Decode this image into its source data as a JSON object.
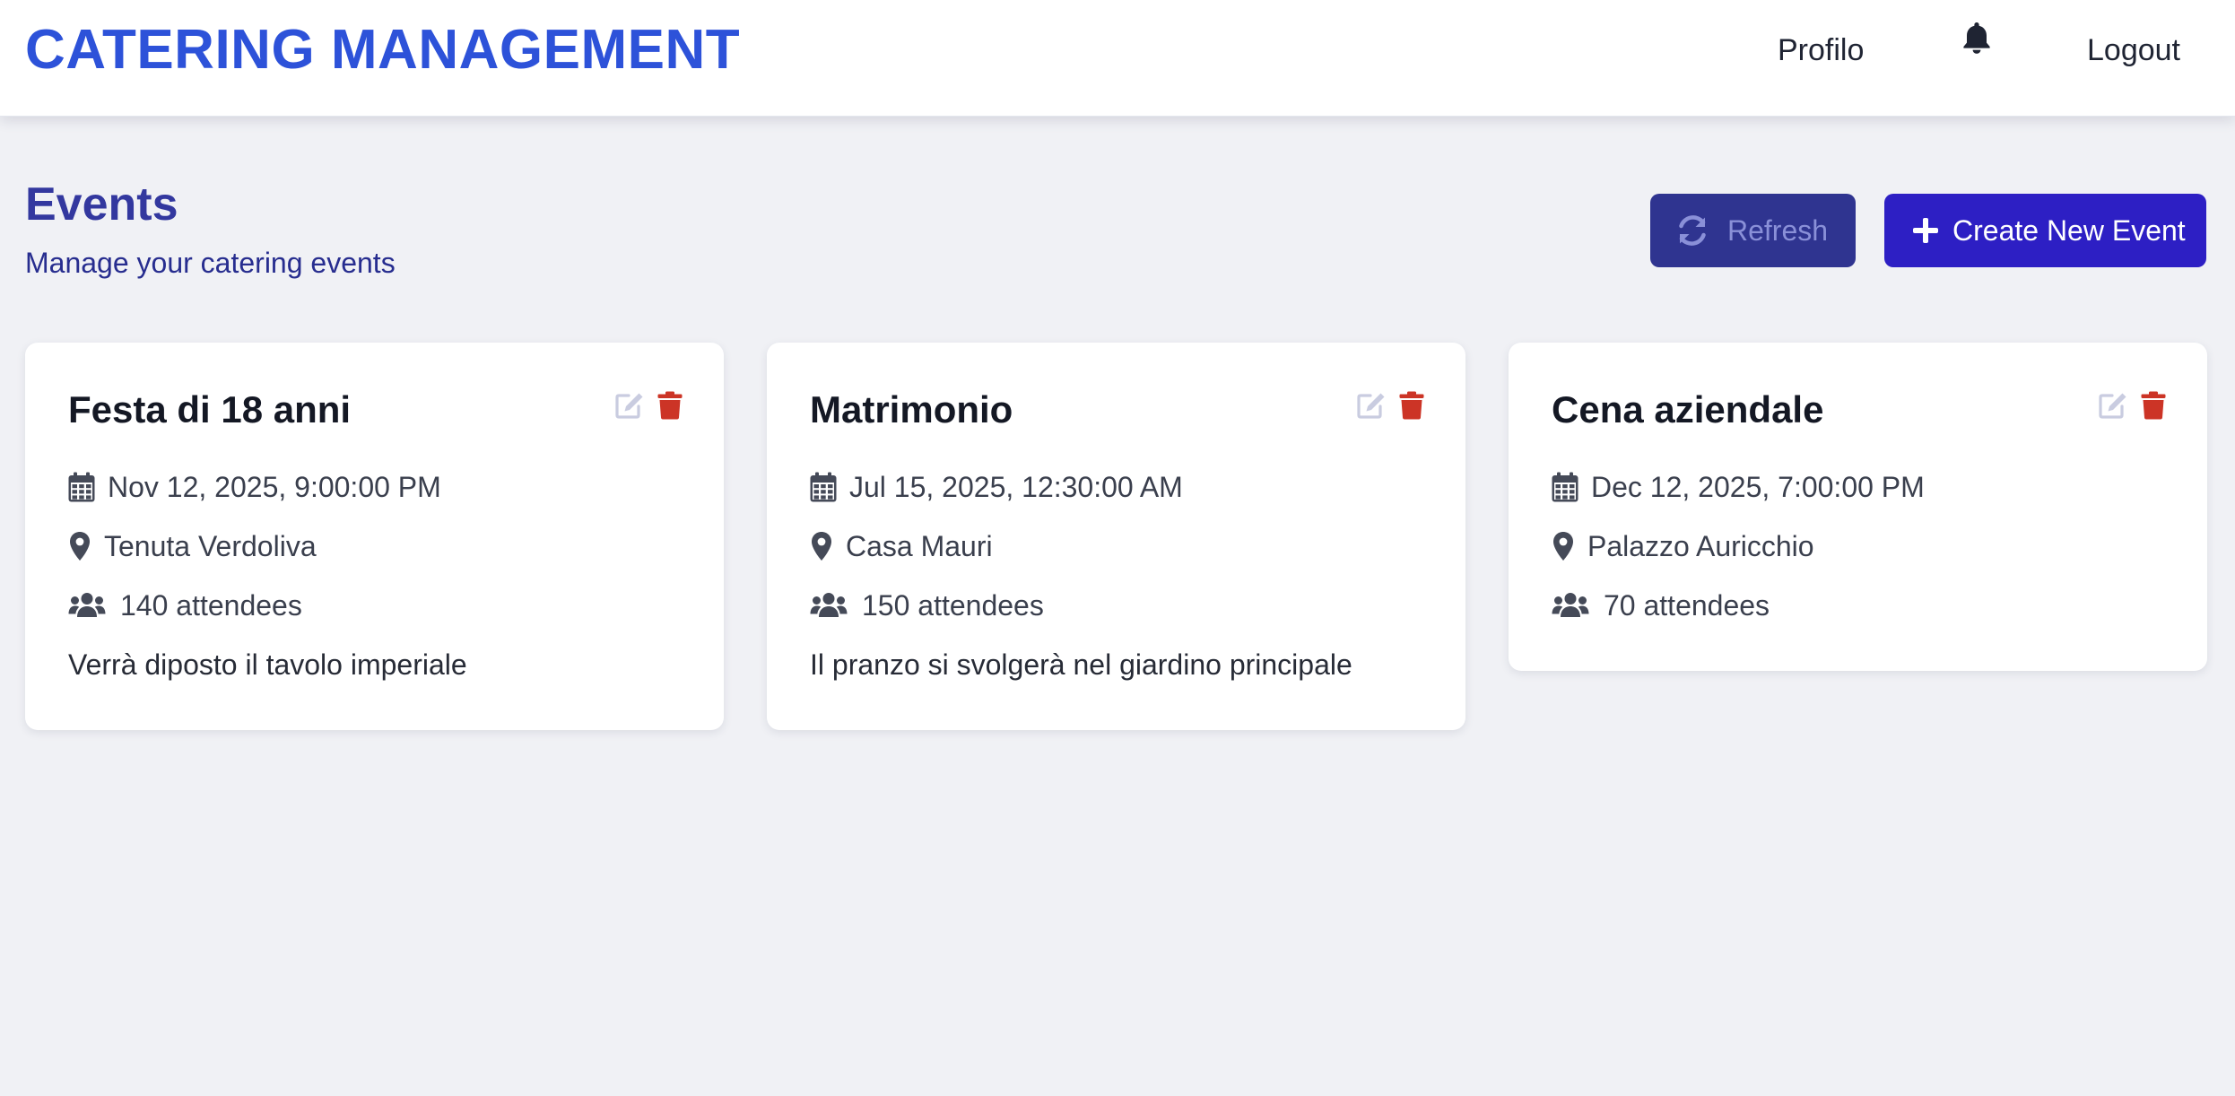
{
  "header": {
    "brand": "CATERING MANAGEMENT",
    "nav": {
      "profile_label": "Profilo",
      "logout_label": "Logout",
      "notifications_icon": "bell-icon"
    }
  },
  "main": {
    "title": "Events",
    "subtitle": "Manage your catering events",
    "actions": {
      "refresh_label": "Refresh",
      "refresh_icon": "sync-icon",
      "create_label": "Create New Event",
      "create_icon": "plus-icon"
    }
  },
  "events": [
    {
      "title": "Festa di 18 anni",
      "date": "Nov 12, 2025, 9:00:00 PM",
      "location": "Tenuta Verdoliva",
      "attendees": "140 attendees",
      "description": "Verrà diposto il tavolo imperiale"
    },
    {
      "title": "Matrimonio",
      "date": "Jul 15, 2025, 12:30:00 AM",
      "location": "Casa Mauri",
      "attendees": "150 attendees",
      "description": "Il pranzo si svolgerà nel giardino principale"
    },
    {
      "title": "Cena aziendale",
      "date": "Dec 12, 2025, 7:00:00 PM",
      "location": "Palazzo Auricchio",
      "attendees": "70 attendees",
      "description": ""
    }
  ],
  "colors": {
    "brand": "#2d52d9",
    "title": "#33389f",
    "refresh_bg": "#2f3490",
    "create_bg": "#2d1fc4",
    "delete": "#cc3426",
    "edit": "#c9cce0",
    "background": "#f0f1f5"
  }
}
